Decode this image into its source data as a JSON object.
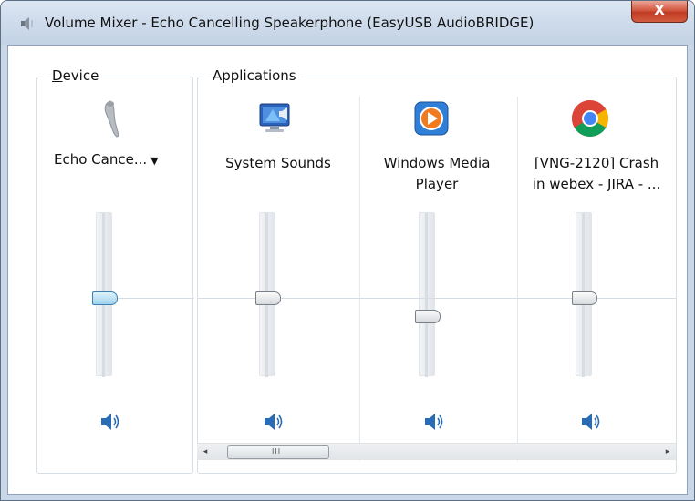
{
  "window": {
    "title": "Volume Mixer - Echo Cancelling Speakerphone (EasyUSB AudioBRIDGE)",
    "close_label": "X",
    "icon": "speaker-small-icon"
  },
  "device_group": {
    "label_underlined": "D",
    "label_rest": "evice",
    "device_name": "Echo Cance...",
    "icon": "speakerphone-handset-icon",
    "volume": 0.53
  },
  "applications_group": {
    "label": "Applications",
    "apps": [
      {
        "name": "System Sounds",
        "icon": "system-sounds-monitor-icon",
        "volume": 0.53
      },
      {
        "name_line1": "Windows Media",
        "name_line2": "Player",
        "icon": "windows-media-player-icon",
        "volume": 0.45
      },
      {
        "name_line1": "[VNG-2120] Crash",
        "name_line2": "in webex - JIRA - ...",
        "icon": "chrome-icon",
        "volume": 0.53
      }
    ]
  },
  "scrollbar": {
    "left_arrow": "◂",
    "right_arrow": "▸",
    "grip": "III"
  },
  "colors": {
    "accent": "#3c7fb1",
    "speaker_blue": "#2a6bb5",
    "close_red": "#c8442c"
  }
}
